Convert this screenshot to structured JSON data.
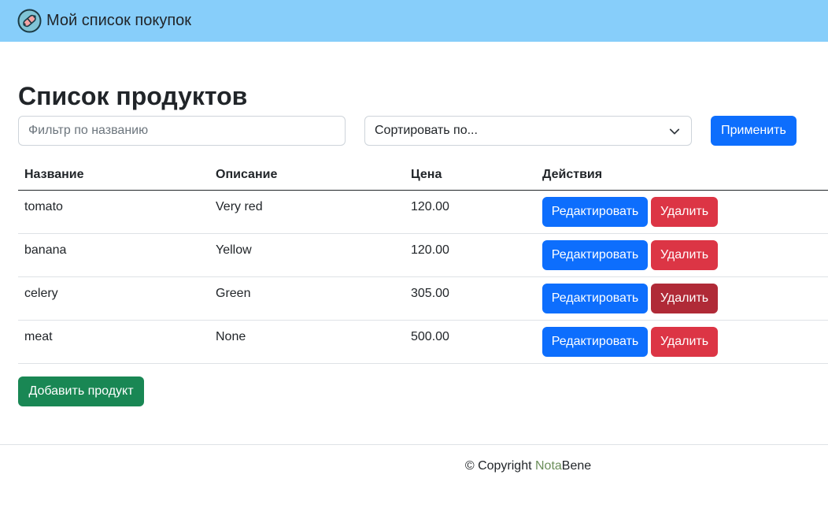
{
  "navbar": {
    "logo_icon": "pill-icon",
    "title": "Мой список покупок"
  },
  "main": {
    "title": "Список продуктов",
    "filter": {
      "placeholder": "Фильтр по названию",
      "value": ""
    },
    "sort": {
      "selected": "Сортировать по...",
      "icon": "chevron-down-icon"
    },
    "apply_label": "Применить",
    "table": {
      "headers": [
        "Название",
        "Описание",
        "Цена",
        "Действия"
      ],
      "rows": [
        {
          "name": "tomato",
          "description": "Very red",
          "price": "120.00",
          "edit": "Редактировать",
          "delete": "Удалить"
        },
        {
          "name": "banana",
          "description": "Yellow",
          "price": "120.00",
          "edit": "Редактировать",
          "delete": "Удалить"
        },
        {
          "name": "celery",
          "description": "Green",
          "price": "305.00",
          "edit": "Редактировать",
          "delete": "Удалить"
        },
        {
          "name": "meat",
          "description": "None",
          "price": "500.00",
          "edit": "Редактировать",
          "delete": "Удалить"
        }
      ]
    },
    "add_label": "Добавить продукт"
  },
  "footer": {
    "prefix": "© Copyright ",
    "brand_a": "Nota",
    "brand_b": "Bene"
  },
  "colors": {
    "navbar": "#87cefa",
    "primary": "#0d6efd",
    "danger": "#dc3545",
    "danger_active": "#b02a37",
    "success": "#198754"
  }
}
